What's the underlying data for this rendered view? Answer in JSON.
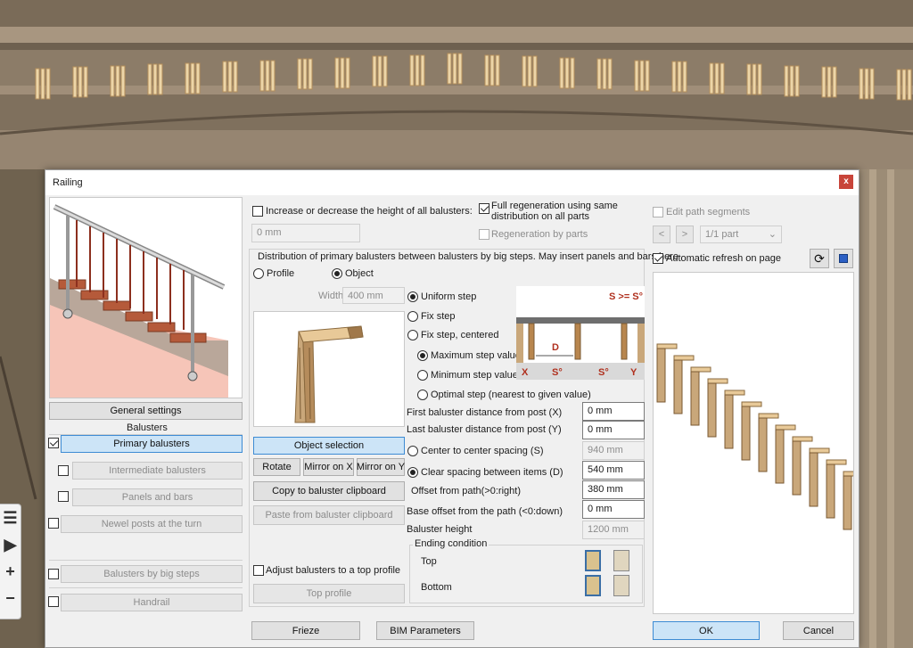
{
  "dialog": {
    "title": "Railing",
    "close_glyph": "x"
  },
  "left_panel": {
    "general_settings": "General settings",
    "balusters_heading": "Balusters",
    "items": [
      {
        "label": "Primary balusters",
        "checked": true
      },
      {
        "label": "Intermediate balusters",
        "checked": false
      },
      {
        "label": "Panels and bars",
        "checked": false
      },
      {
        "label": "Newel posts at the turn",
        "checked": false
      },
      {
        "label": "Balusters by big steps",
        "checked": false
      },
      {
        "label": "Handrail",
        "checked": false
      }
    ]
  },
  "middle": {
    "increase_height_label": "Increase or decrease the height of all balusters:",
    "increase_height_value": "0 mm",
    "full_regen_label_1": "Full regeneration using same",
    "full_regen_label_2": "distribution on all parts",
    "regen_by_parts_label": "Regeneration by parts",
    "distribution_title": "Distribution of primary balusters between balusters by big steps. May insert panels and bars here",
    "profile_label": "Profile",
    "object_label": "Object",
    "width_label": "Width",
    "width_value": "400 mm",
    "object_selection": "Object selection",
    "rotate": "Rotate",
    "mirror_x": "Mirror on X",
    "mirror_y": "Mirror on Y",
    "copy_clipboard": "Copy to baluster clipboard",
    "paste_clipboard": "Paste from baluster clipboard",
    "adjust_top_label": "Adjust balusters to a top profile",
    "top_profile": "Top profile",
    "uniform_step": "Uniform step",
    "fix_step": "Fix step",
    "fix_step_centered": "Fix step, centered",
    "max_step": "Maximum step value",
    "min_step": "Minimum step value",
    "optimal_step": "Optimal step (nearest to given value)",
    "diagram": {
      "formula": "S >= S°",
      "d_label": "D",
      "x_label": "X",
      "s1_label": "S°",
      "s2_label": "S°",
      "y_label": "Y"
    },
    "first_dist_label": "First baluster distance from post (X)",
    "first_dist_value": "0 mm",
    "last_dist_label": "Last baluster distance from post (Y)",
    "last_dist_value": "0 mm",
    "center_spacing_label": "Center to center spacing (S)",
    "center_spacing_value": "940 mm",
    "clear_spacing_label": "Clear spacing between items (D)",
    "clear_spacing_value": "540 mm",
    "offset_path_label": "Offset from path(>0:right)",
    "offset_path_value": "380 mm",
    "base_offset_label": "Base offset from the path (<0:down)",
    "base_offset_value": "0 mm",
    "baluster_height_label": "Baluster height",
    "baluster_height_value": "1200 mm",
    "ending_condition": "Ending condition",
    "top_label": "Top",
    "bottom_label": "Bottom"
  },
  "right_panel": {
    "edit_path_label": "Edit path segments",
    "prev_glyph": "<",
    "next_glyph": ">",
    "part_value": "1/1 part",
    "auto_refresh_label": "Automatic refresh on page",
    "refresh_icon": "refresh-icon",
    "view_icon": "3d-view-icon"
  },
  "footer": {
    "frieze": "Frieze",
    "bim": "BIM Parameters",
    "ok": "OK",
    "cancel": "Cancel"
  },
  "colors": {
    "accent": "#3d8bd4",
    "wood": "#c9a77a",
    "close": "#c8453a"
  }
}
